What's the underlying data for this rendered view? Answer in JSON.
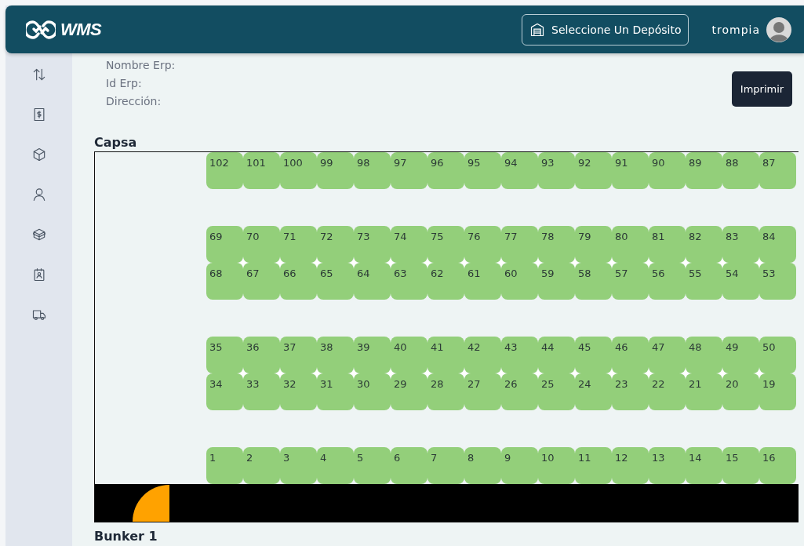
{
  "header": {
    "logo": "WMS",
    "warehouse_button": "Seleccione Un Depósito",
    "user": "trompia"
  },
  "details": [
    "Nombre Erp:",
    "Id Erp:",
    "Dirección:"
  ],
  "print_button": "Imprimir",
  "sections": [
    {
      "title": "Capsa",
      "rows": [
        {
          "kind": "rack",
          "joined": false,
          "cells": [
            "102",
            "101",
            "100",
            "99",
            "98",
            "97",
            "96",
            "95",
            "94",
            "93",
            "92",
            "91",
            "90",
            "89",
            "88",
            "87"
          ]
        },
        {
          "kind": "aisle"
        },
        {
          "kind": "rack",
          "joined": false,
          "cells": [
            "69",
            "70",
            "71",
            "72",
            "73",
            "74",
            "75",
            "76",
            "77",
            "78",
            "79",
            "80",
            "81",
            "82",
            "83",
            "84"
          ]
        },
        {
          "kind": "rack",
          "joined": true,
          "cells": [
            "68",
            "67",
            "66",
            "65",
            "64",
            "63",
            "62",
            "61",
            "60",
            "59",
            "58",
            "57",
            "56",
            "55",
            "54",
            "53"
          ]
        },
        {
          "kind": "aisle"
        },
        {
          "kind": "rack",
          "joined": false,
          "cells": [
            "35",
            "36",
            "37",
            "38",
            "39",
            "40",
            "41",
            "42",
            "43",
            "44",
            "45",
            "46",
            "47",
            "48",
            "49",
            "50"
          ]
        },
        {
          "kind": "rack",
          "joined": true,
          "cells": [
            "34",
            "33",
            "32",
            "31",
            "30",
            "29",
            "28",
            "27",
            "26",
            "25",
            "24",
            "23",
            "22",
            "21",
            "20",
            "19"
          ]
        },
        {
          "kind": "aisle"
        },
        {
          "kind": "rack",
          "joined": false,
          "cells": [
            "1",
            "2",
            "3",
            "4",
            "5",
            "6",
            "7",
            "8",
            "9",
            "10",
            "11",
            "12",
            "13",
            "14",
            "15",
            "16"
          ]
        },
        {
          "kind": "door"
        }
      ]
    },
    {
      "title": "Bunker 1"
    }
  ]
}
